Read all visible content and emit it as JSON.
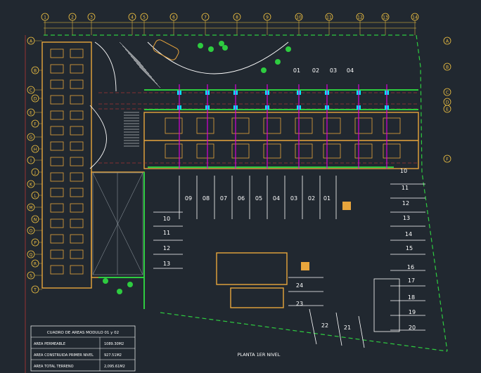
{
  "title": "PLANTA 1ER NIVEL",
  "grid_columns": [
    "1",
    "2",
    "3",
    "4",
    "5",
    "6",
    "7",
    "8",
    "9",
    "10",
    "11",
    "12",
    "13",
    "14"
  ],
  "grid_rows_right": [
    "A",
    "B",
    "C",
    "D",
    "E",
    "F"
  ],
  "grid_rows_left": [
    "A",
    "B",
    "C",
    "D",
    "E",
    "F",
    "G",
    "H",
    "I",
    "J",
    "K",
    "L",
    "M",
    "N",
    "O",
    "P",
    "Q",
    "R",
    "S",
    "T"
  ],
  "modules_top": [
    "01",
    "02",
    "03",
    "04"
  ],
  "parking_row_top": [
    "09",
    "08",
    "07",
    "06",
    "05",
    "04",
    "03",
    "02",
    "01"
  ],
  "parking_left": [
    "10",
    "11",
    "12",
    "13"
  ],
  "parking_right": [
    "10",
    "11",
    "12",
    "13",
    "14",
    "15",
    "16",
    "17",
    "18",
    "19",
    "20"
  ],
  "parking_bottom": [
    "24",
    "23",
    "22",
    "21"
  ],
  "areas_table": {
    "header": "CUADRO DE AREAS MODULO 01 y 02",
    "rows": [
      {
        "label": "AREA PERMEABLE",
        "value": "1089.30M2"
      },
      {
        "label": "AREA CONSTRUIDA  PRIMER NIVEL",
        "value": "927.51M2"
      },
      {
        "label": "AREA TOTAL TERRENO",
        "value": "2,095.61M2"
      }
    ]
  },
  "colors": {
    "background": "#212830",
    "grid_line": "#f5c542",
    "red_axis": "#e53935",
    "wall": "#e8a53c",
    "green": "#2ecc40",
    "cyan": "#00e5ff",
    "magenta": "#d600d6",
    "white": "#ffffff"
  }
}
